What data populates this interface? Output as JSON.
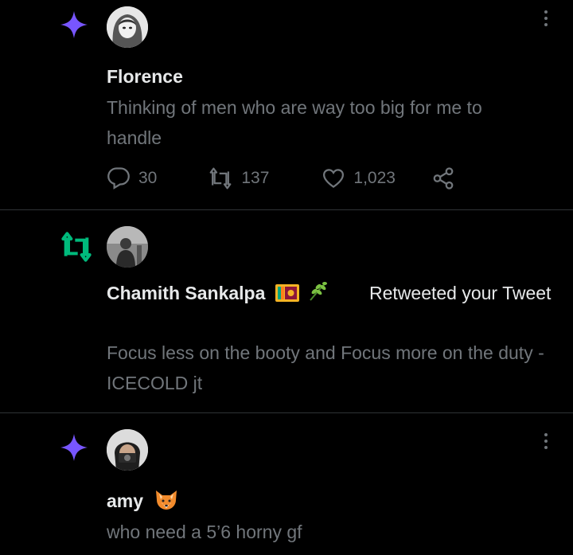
{
  "notifications": [
    {
      "type": "like",
      "name": "Florence",
      "text": "Thinking of men who are way too big for me to handle",
      "stats": {
        "replies": "30",
        "retweets": "137",
        "likes": "1,023"
      }
    },
    {
      "type": "retweet",
      "name": "Chamith Sankalpa",
      "action_text": "Retweeted your Tweet",
      "text": "Focus less on the booty and Focus more on the duty - ICECOLD jt"
    },
    {
      "type": "like",
      "name": "amy",
      "text": "who need a 5’6 horny gf"
    }
  ],
  "colors": {
    "background": "#000000",
    "primary_text": "#e7e9ea",
    "secondary_text": "#71767b",
    "divider": "#2f3336",
    "spark_purple": "#7856ff",
    "retweet_green": "#00ba7c"
  },
  "icons": {
    "like_notification": "sparkle-icon",
    "retweet_notification": "retweet-icon",
    "reply": "reply-bubble-icon",
    "retweet": "retweet-icon",
    "like": "heart-icon",
    "share": "share-icon",
    "more": "more-vertical-icon"
  }
}
